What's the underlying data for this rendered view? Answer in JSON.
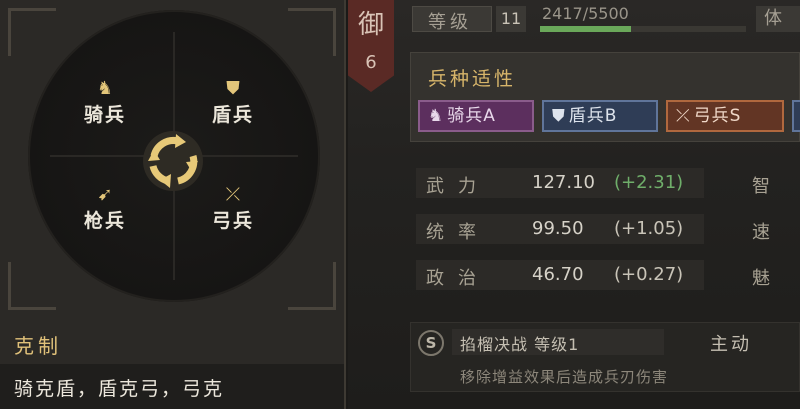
{
  "left": {
    "units": {
      "cavalry": {
        "label": "骑兵",
        "icon": "horse-icon"
      },
      "shield": {
        "label": "盾兵",
        "icon": "shield-icon"
      },
      "spear": {
        "label": "枪兵",
        "icon": "spear-icon"
      },
      "bow": {
        "label": "弓兵",
        "icon": "bow-icon"
      }
    },
    "cycle_icon": "cycle-arrows-icon",
    "counter_title": "克制",
    "counter_text": "骑克盾，盾克弓，弓克"
  },
  "right": {
    "banner": {
      "char": "御",
      "number": "6"
    },
    "level": {
      "label": "等级",
      "value": "11"
    },
    "xp": {
      "text": "2417/5500",
      "current": 2417,
      "max": 5500
    },
    "stat_cut": "体",
    "suitability": {
      "title": "兵种适性",
      "tags": [
        {
          "label": "骑兵A",
          "icon": "horse-icon"
        },
        {
          "label": "盾兵B",
          "icon": "shield-icon"
        },
        {
          "label": "弓兵S",
          "icon": "bow-icon"
        }
      ]
    },
    "stats": [
      {
        "name": "武力",
        "value": "127.10",
        "bonus": "(+2.31)",
        "right": "智"
      },
      {
        "name": "统率",
        "value": "99.50",
        "bonus": "(+1.05)",
        "right": "速"
      },
      {
        "name": "政治",
        "value": "46.70",
        "bonus": "(+0.27)",
        "right": "魅"
      }
    ],
    "skill": {
      "badge": "S",
      "name": "掐榴决战 等级1",
      "type": "主动",
      "desc": "移除增益效果后造成兵刃伤害"
    }
  },
  "colors": {
    "gold": "#e0c17a",
    "cavalry_tag": "#5c2f5e",
    "shield_tag": "#2f3d56",
    "bow_tag": "#623524",
    "xp_green": "#6aa85a",
    "bonus_green": "#6fae6a"
  }
}
